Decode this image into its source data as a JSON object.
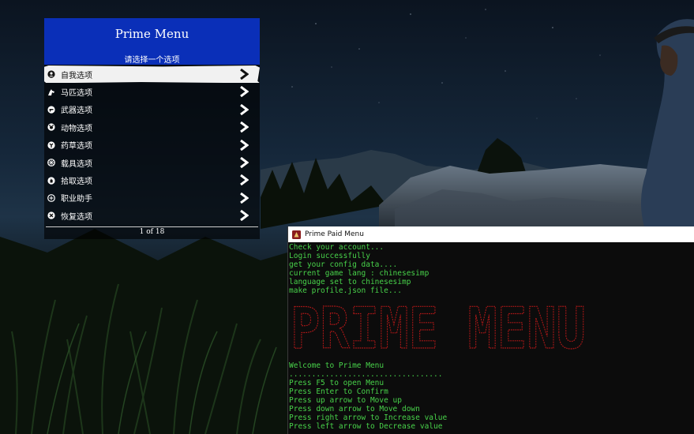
{
  "menu": {
    "title": "Prime Menu",
    "subtitle": "请选择一个选项",
    "items": [
      {
        "label": "自我选项",
        "icon": "person-icon",
        "selected": true
      },
      {
        "label": "马匹选项",
        "icon": "horse-icon",
        "selected": false
      },
      {
        "label": "武器选项",
        "icon": "revolver-icon",
        "selected": false
      },
      {
        "label": "动物选项",
        "icon": "animal-icon",
        "selected": false
      },
      {
        "label": "药草选项",
        "icon": "herb-icon",
        "selected": false
      },
      {
        "label": "载具选项",
        "icon": "wagon-wheel-icon",
        "selected": false
      },
      {
        "label": "拾取选项",
        "icon": "hand-icon",
        "selected": false
      },
      {
        "label": "职业助手",
        "icon": "role-icon",
        "selected": false
      },
      {
        "label": "恢复选项",
        "icon": "restore-icon",
        "selected": false
      }
    ],
    "page_indicator": "1 of 18",
    "colors": {
      "header": "#0a2fb8",
      "selected": "#f1f1f1"
    }
  },
  "console": {
    "window_title": "Prime Paid Menu",
    "lines_top": [
      "Check your account...",
      "Login successfully",
      "get your config data....",
      "current game lang : chinesesimp",
      "language set to chinesesimp",
      "make profile.json file..."
    ],
    "banner": "PRIME MENU",
    "lines_bottom": [
      "Welcome to Prime Menu",
      "..................................",
      "Press F5 to open Menu",
      "Press Enter to Confirm",
      "Press up arrow to Move up",
      "Press down arrow to Move down",
      "Press right arrow to Increase value",
      "Press left arrow to Decrease value"
    ],
    "colors": {
      "text": "#48d24a",
      "banner": "#b01818"
    }
  }
}
